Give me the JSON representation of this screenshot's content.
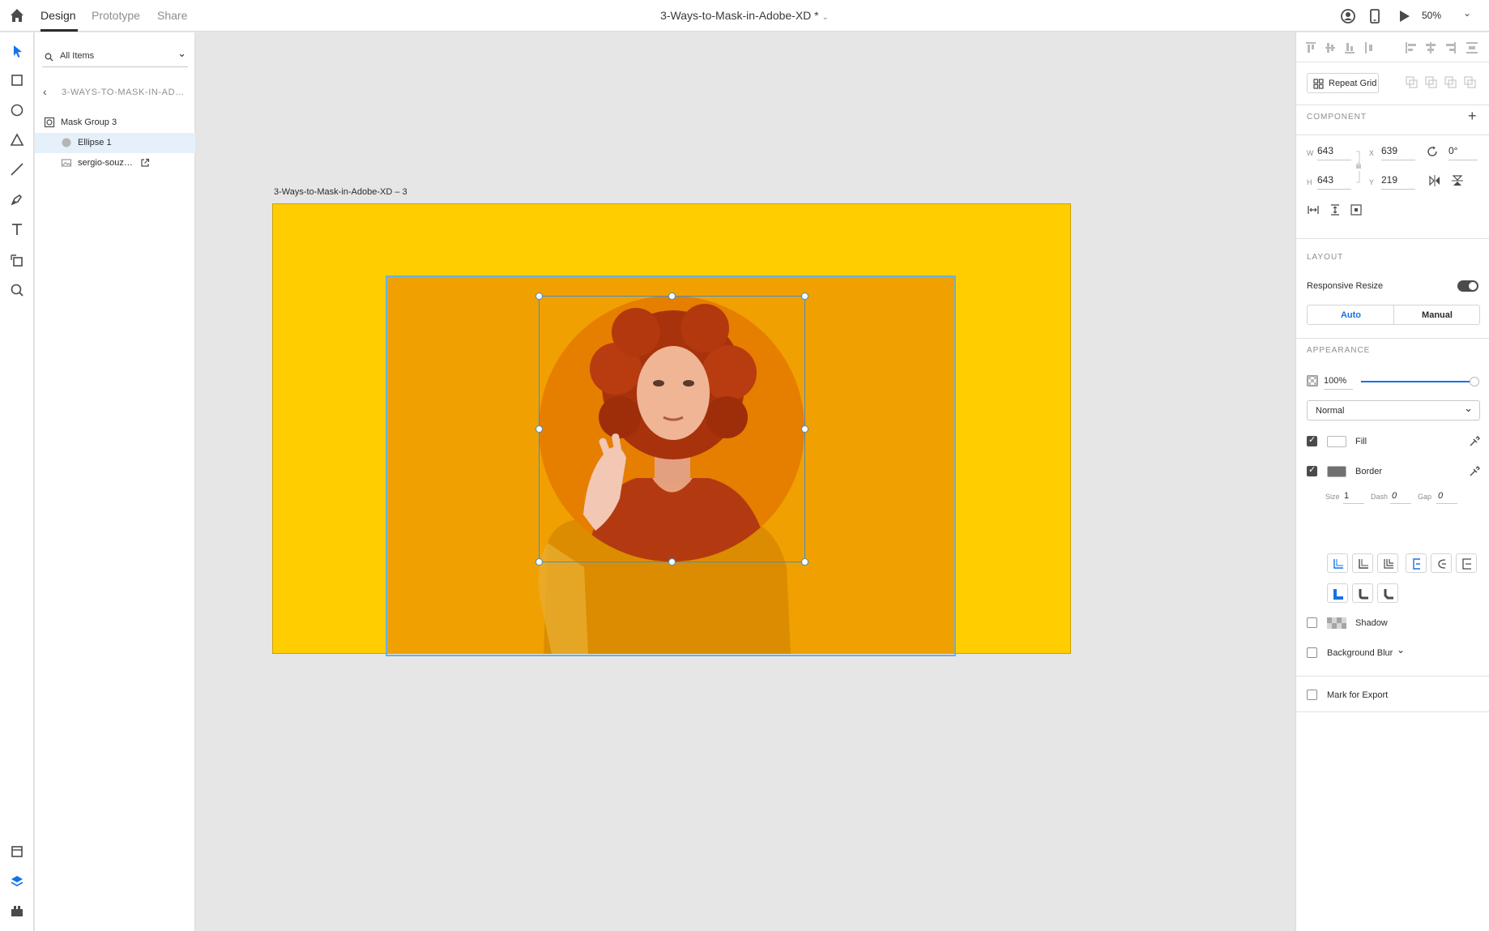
{
  "topbar": {
    "tabs": [
      "Design",
      "Prototype",
      "Share"
    ],
    "document_title": "3-Ways-to-Mask-in-Adobe-XD *",
    "zoom": "50%"
  },
  "layers": {
    "search_label": "All Items",
    "breadcrumb": "3-WAYS-TO-MASK-IN-AD…",
    "items": [
      {
        "label": "Mask Group 3"
      },
      {
        "label": "Ellipse 1"
      },
      {
        "label": "sergio-souz…"
      }
    ]
  },
  "canvas": {
    "artboard_label": "3-Ways-to-Mask-in-Adobe-XD – 3"
  },
  "props": {
    "repeat_grid": "Repeat Grid",
    "component_title": "COMPONENT",
    "w_label": "W",
    "w": "643",
    "h_label": "H",
    "h": "643",
    "x_label": "X",
    "x": "639",
    "y_label": "Y",
    "y": "219",
    "rotation": "0°",
    "layout_title": "LAYOUT",
    "responsive_resize": "Responsive Resize",
    "auto": "Auto",
    "manual": "Manual",
    "appearance_title": "APPEARANCE",
    "opacity": "100%",
    "blend_mode": "Normal",
    "fill": "Fill",
    "border": "Border",
    "size_label": "Size",
    "size": "1",
    "dash_label": "Dash",
    "dash": "0",
    "gap_label": "Gap",
    "gap": "0",
    "shadow": "Shadow",
    "background_blur": "Background Blur",
    "mark_for_export": "Mark for Export"
  },
  "colors": {
    "artboard": "#ffcd00",
    "image_bg": "#f0a000",
    "accent": "#1473e6",
    "selection": "#3f8fcf",
    "layer_selected": "#e5f0fb"
  },
  "icons": [
    "home-icon",
    "user-icon",
    "mobile-preview-icon",
    "play-icon",
    "chevron-down-icon",
    "select-tool-icon",
    "rectangle-tool-icon",
    "ellipse-tool-icon",
    "polygon-tool-icon",
    "line-tool-icon",
    "pen-tool-icon",
    "text-tool-icon",
    "artboard-tool-icon",
    "zoom-tool-icon",
    "assets-icon",
    "layers-icon",
    "plugins-icon",
    "search-icon",
    "lock-icon",
    "eyedropper-icon"
  ]
}
